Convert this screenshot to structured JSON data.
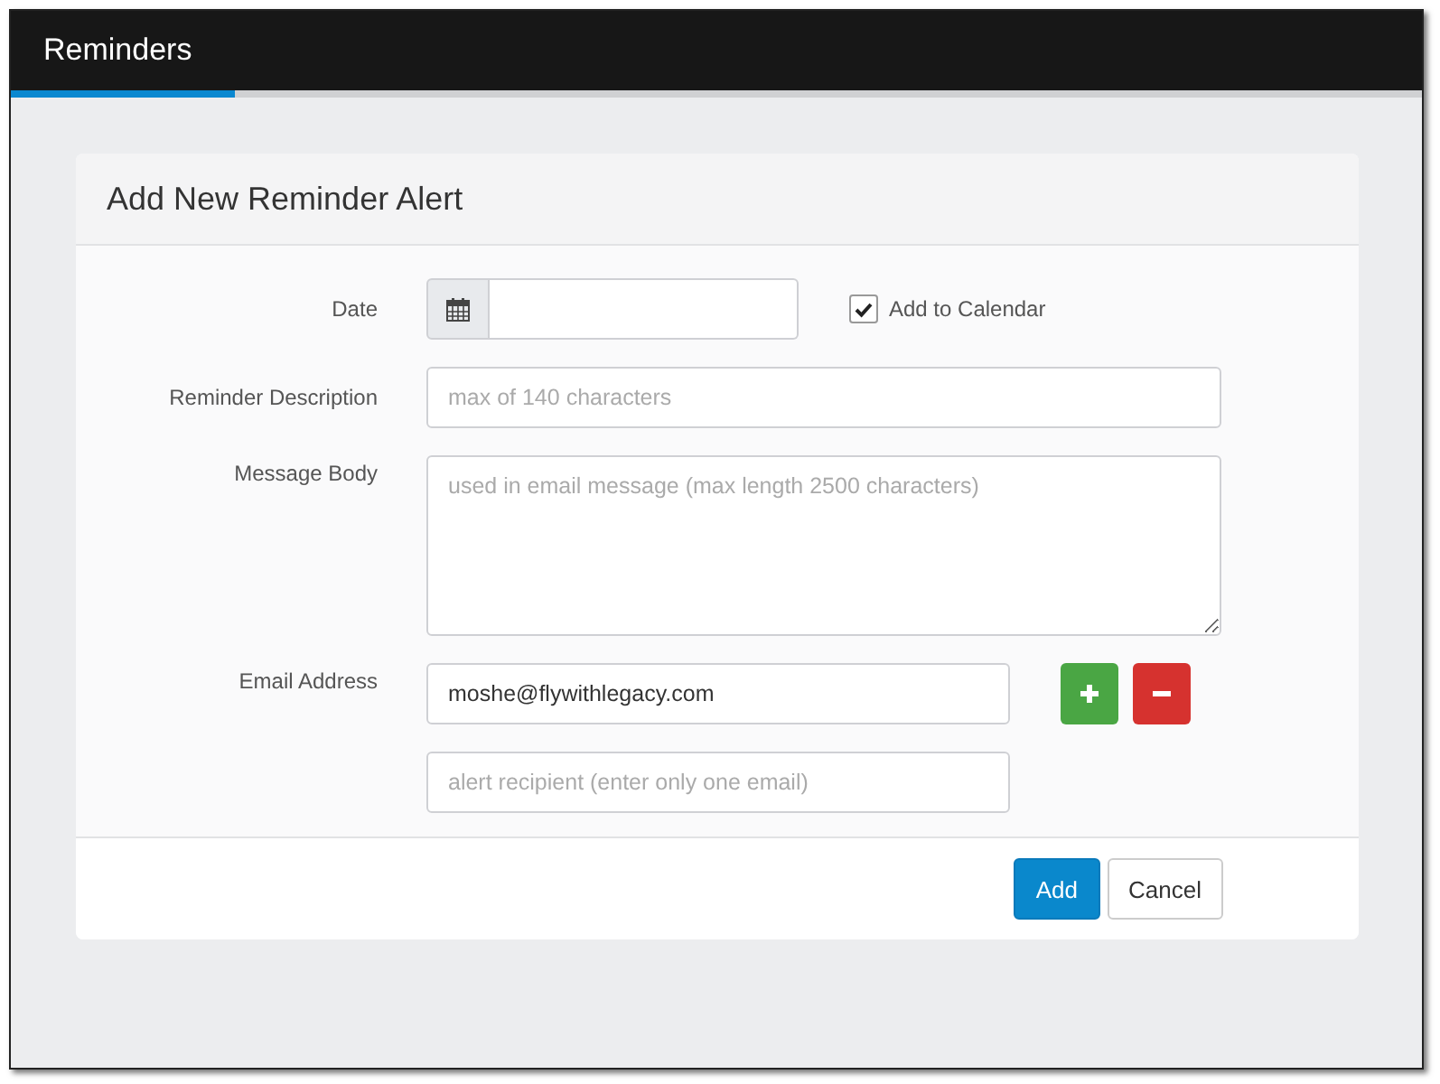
{
  "app_bar": {
    "tabs": [
      {
        "label": "Reminders",
        "selected": true
      }
    ]
  },
  "panel": {
    "title": "Add New Reminder Alert",
    "date": {
      "label": "Date",
      "add_to_calendar": {
        "label": "Add to Calendar",
        "checked": true
      }
    },
    "description": {
      "label": "Reminder Description",
      "placeholder": "max of 140 characters"
    },
    "message_body": {
      "label": "Message Body",
      "placeholder": "used in email message (max length 2500 characters)"
    },
    "email": {
      "label": "Email Address",
      "fields": [
        {
          "value": "moshe@flywithlegacy.com"
        },
        {
          "placeholder": "alert recipient (enter only one email)"
        }
      ]
    },
    "buttons": [
      {
        "label": "Add",
        "kind": "primary"
      },
      {
        "label": "Cancel",
        "kind": "default"
      }
    ]
  }
}
